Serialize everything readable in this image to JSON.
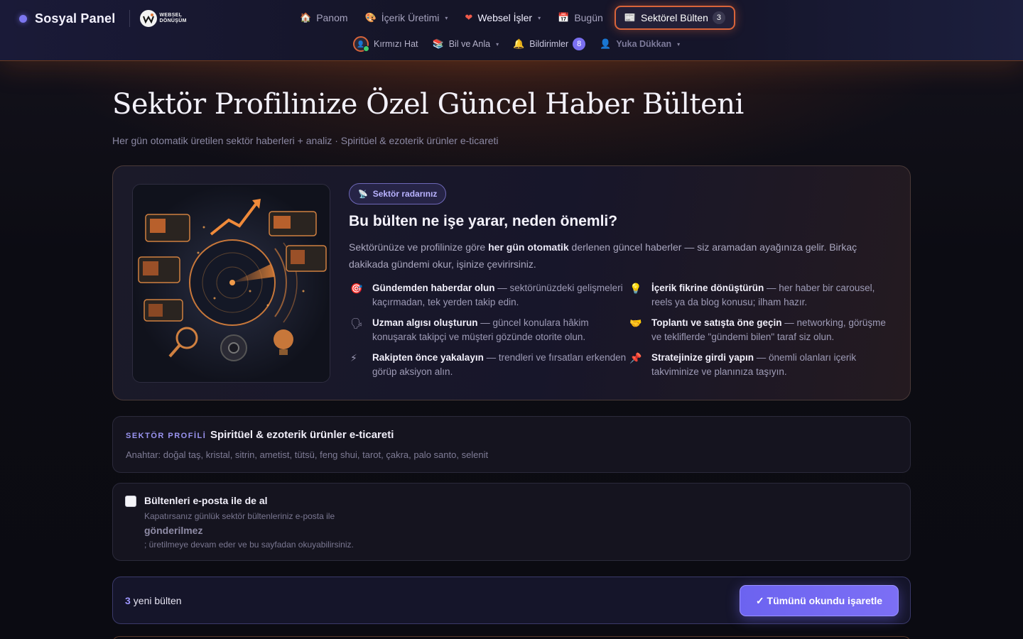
{
  "brand": {
    "name": "Sosyal Panel",
    "partner_line1": "WEBSEL",
    "partner_line2": "DÖNÜŞÜM"
  },
  "nav": {
    "primary": [
      {
        "label": "Panom",
        "icon": "house-icon"
      },
      {
        "label": "İçerik Üretimi",
        "icon": "palette-icon",
        "dropdown": true
      },
      {
        "label": "Websel İşler",
        "icon": "heart-icon",
        "dropdown": true
      },
      {
        "label": "Bugün",
        "icon": "calendar-icon"
      },
      {
        "label": "Sektörel Bülten",
        "icon": "newspaper-icon",
        "badge": "3",
        "active": true
      }
    ],
    "secondary": [
      {
        "label": "Kırmızı Hat",
        "icon": "avatar-icon"
      },
      {
        "label": "Bil ve Anla",
        "icon": "books-icon",
        "dropdown": true
      },
      {
        "label": "Bildirimler",
        "icon": "bell-icon",
        "badge": "8"
      },
      {
        "label": "Yuka Dükkan",
        "icon": "person-icon",
        "dropdown": true
      }
    ]
  },
  "page": {
    "title": "Sektör Profilinize Özel Güncel Haber Bülteni",
    "subtitle": "Her gün otomatik üretilen sektör haberleri + analiz · Spiritüel & ezoterik ürünler e-ticareti"
  },
  "hero": {
    "pill": "Sektör radarınız",
    "heading": "Bu bülten ne işe yarar, neden önemli?",
    "intro_a": "Sektörünüze ve profilinize göre ",
    "intro_bold": "her gün otomatik",
    "intro_b": " derlenen güncel haberler — siz aramadan ayağınıza gelir. Birkaç dakikada gündemi okur, işinize çevirirsiniz.",
    "benefits": [
      {
        "icon": "target-icon",
        "glyph": "🎯",
        "bold": "Gündemden haberdar olun",
        "text": " — sektörünüzdeki gelişmeleri kaçırmadan, tek yerden takip edin."
      },
      {
        "icon": "lightbulb-icon",
        "glyph": "💡",
        "bold": "İçerik fikrine dönüştürün",
        "text": " — her haber bir carousel, reels ya da blog konusu; ilham hazır."
      },
      {
        "icon": "speech-icon",
        "glyph": "🗣",
        "bold": "Uzman algısı oluşturun",
        "text": " — güncel konulara hâkim konuşarak takipçi ve müşteri gözünde otorite olun."
      },
      {
        "icon": "handshake-icon",
        "glyph": "🤝",
        "bold": "Toplantı ve satışta öne geçin",
        "text": " — networking, görüşme ve tekliflerde \"gündemi bilen\" taraf siz olun."
      },
      {
        "icon": "lightning-icon",
        "glyph": "⚡",
        "bold": "Rakipten önce yakalayın",
        "text": " — trendleri ve fırsatları erkenden görüp aksiyon alın."
      },
      {
        "icon": "pin-icon",
        "glyph": "📌",
        "bold": "Stratejinize girdi yapın",
        "text": " — önemli olanları içerik takviminize ve planınıza taşıyın."
      }
    ]
  },
  "profile": {
    "label": "SEKTÖR PROFİLİ",
    "value": "Spiritüel & ezoterik ürünler e-ticareti",
    "keywords": "Anahtar: doğal taş, kristal, sitrin, ametist, tütsü, feng shui, tarot, çakra, palo santo, selenit"
  },
  "email": {
    "title": "Bültenleri e-posta ile de al",
    "desc1": "Kapatırsanız günlük sektör bültenleriniz e-posta ile",
    "desc2": "gönderilmez",
    "desc3": "; üretilmeye devam eder ve bu sayfadan okuyabilirsiniz.",
    "checked": false
  },
  "newbar": {
    "count": "3",
    "text": "yeni bülten",
    "button": "✓ Tümünü okundu işaretle"
  },
  "colors": {
    "accent": "#6c63f0",
    "active_border": "#d9643a",
    "background": "#0c0c14"
  }
}
